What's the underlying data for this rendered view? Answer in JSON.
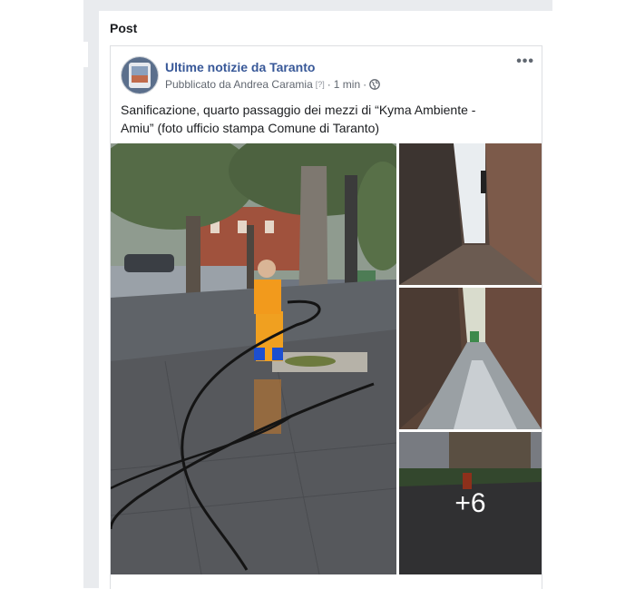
{
  "section": {
    "title": "Post"
  },
  "post": {
    "page_name": "Ultime notizie da Taranto",
    "published_by": "Pubblicato da Andrea Caramia",
    "bracket_label": "[?]",
    "separator": "·",
    "time": "1 min",
    "more_icon": "more-horizontal-icon",
    "privacy_icon": "globe-icon",
    "text": "Sanificazione, quarto passaggio dei mezzi di “Kyma Ambiente - Amiu” (foto ufficio stampa Comune di Taranto)",
    "more_photos": "+6"
  },
  "colors": {
    "link": "#385898",
    "meta": "#616770",
    "background": "#e9ebee"
  }
}
